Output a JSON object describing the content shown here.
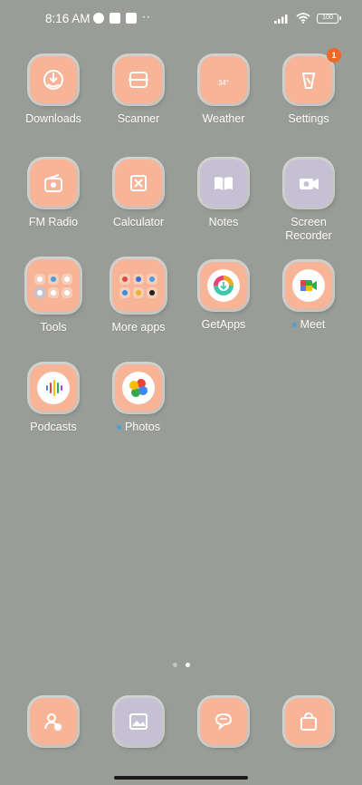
{
  "status": {
    "time": "8:16 AM",
    "battery": "100"
  },
  "apps": [
    {
      "label": "Downloads"
    },
    {
      "label": "Scanner"
    },
    {
      "label": "Weather",
      "weather_text": "34°"
    },
    {
      "label": "Settings",
      "badge": "1"
    },
    {
      "label": "FM Radio"
    },
    {
      "label": "Calculator"
    },
    {
      "label": "Notes"
    },
    {
      "label": "Screen Recorder"
    },
    {
      "label": "Tools"
    },
    {
      "label": "More apps"
    },
    {
      "label": "GetApps"
    },
    {
      "label": "Meet"
    },
    {
      "label": "Podcasts"
    },
    {
      "label": "Photos"
    }
  ],
  "colors": {
    "background": "#9a9d97",
    "tile_peach": "#f7b497",
    "tile_lavender": "#c6c0d4",
    "badge": "#f06724",
    "new_dot": "#4a9fe0"
  }
}
